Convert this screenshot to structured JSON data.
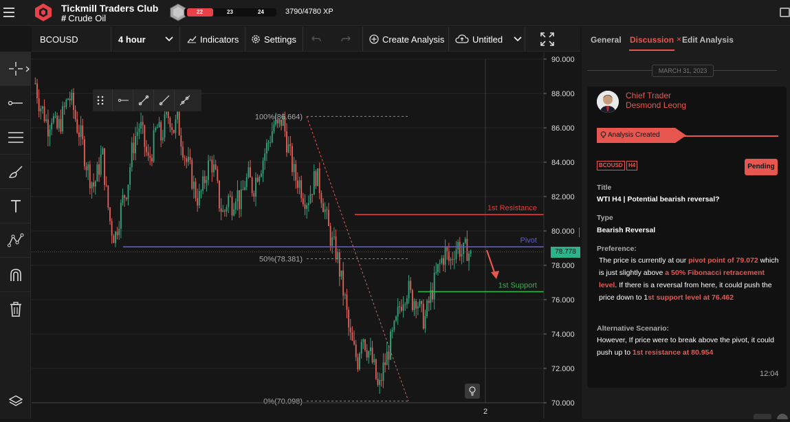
{
  "header": {
    "club_title": "Tickmill Traders Club",
    "club_sub": "Crude Oil",
    "level_current": "22",
    "level_mid": "23",
    "level_next": "24",
    "xp_text": "3790/4780 XP",
    "accent": "#e8414a"
  },
  "toolbar": {
    "symbol": "BCOUSD",
    "interval": "4 hour",
    "indicators": "Indicators",
    "settings": "Settings",
    "create_analysis": "Create Analysis",
    "untitled": "Untitled"
  },
  "left_tools": [
    {
      "icon": "crosshair-icon"
    },
    {
      "icon": "line-tool-icon"
    },
    {
      "icon": "fib-lines-icon"
    },
    {
      "icon": "brush-icon"
    },
    {
      "icon": "text-icon"
    },
    {
      "icon": "pattern-icon"
    },
    {
      "icon": "magnet-icon"
    },
    {
      "icon": "trash-icon"
    },
    {
      "icon": "layers-icon"
    }
  ],
  "chart_data": {
    "type": "candlestick",
    "y_ticks": [
      "90.000",
      "88.000",
      "86.000",
      "84.000",
      "82.000",
      "80.000",
      "78.000",
      "76.000",
      "74.000",
      "72.000",
      "70.000"
    ],
    "ylim": [
      70,
      90
    ],
    "x_tick": "2",
    "current_price": "78.778",
    "fib_levels": [
      {
        "label": "100%(86.664)",
        "value": 86.664
      },
      {
        "label": "50%(78.381)",
        "value": 78.381
      },
      {
        "label": "0%(70.098)",
        "value": 70.098
      }
    ],
    "lines": [
      {
        "label": "1st Resistance",
        "value": 80.954,
        "color": "#e23b3b"
      },
      {
        "label": "Pivot",
        "value": 79.072,
        "color": "#5b5bd6"
      },
      {
        "label": "1st Support",
        "value": 76.462,
        "color": "#2fb84a"
      }
    ],
    "close_path": [
      88.6,
      87.4,
      86.9,
      86.1,
      86.8,
      85.8,
      86.3,
      87.1,
      87.9,
      87.2,
      86.1,
      85.4,
      84.1,
      83.2,
      82.6,
      83.5,
      84.6,
      82.1,
      80.3,
      79.6,
      80.8,
      81.9,
      82.6,
      84.5,
      85.6,
      86.2,
      85.1,
      84.0,
      84.8,
      86.1,
      85.4,
      86.3,
      86.8,
      85.9,
      86.4,
      85.2,
      84.1,
      83.5,
      82.4,
      81.8,
      82.5,
      83.6,
      84.1,
      83.2,
      81.6,
      80.9,
      82.0,
      81.6,
      82.4,
      81.5,
      82.8,
      83.1,
      82.4,
      83.4,
      83.9,
      84.7,
      85.4,
      86.2,
      85.9,
      86.6,
      85.3,
      84.2,
      83.1,
      82.9,
      82.1,
      81.8,
      82.5,
      83.3,
      82.5,
      81.4,
      80.1,
      79.2,
      78.7,
      77.2,
      75.9,
      74.0,
      73.1,
      72.4,
      74.2,
      73.3,
      72.8,
      71.9,
      70.6,
      71.9,
      72.7,
      73.6,
      74.4,
      75.6,
      76.3,
      76.7,
      75.9,
      76.2,
      75.2,
      74.8,
      75.8,
      76.7,
      77.6,
      78.3,
      78.8,
      78.1,
      78.9,
      79.2,
      78.6,
      79.0,
      78.5
    ]
  },
  "panel": {
    "tab_general": "General",
    "tab_discussion": "Discussion",
    "tab_edit": "Edit Analysis",
    "date": "MARCH 31, 2023",
    "role": "Chief Trader",
    "name": "Desmond Leong",
    "status": "Analysis Created",
    "tag1": "BCOUSD",
    "tag2": "H4",
    "pending": "Pending",
    "title_label": "Title",
    "title_value": "WTI H4 | Potential bearish reversal?",
    "type_label": "Type",
    "type_value": "Bearish Reversal",
    "pref_label": "Preference:",
    "pref_1": "The price is currently at our ",
    "pref_hl1": "pivot point of 79.072",
    "pref_2": " which is just slightly above ",
    "pref_hl2": "a 50% Fibonacci retracement level",
    "pref_3": ". If there is a reversal from here, it could push the price down to 1",
    "pref_hl3": "st support level at 76.462",
    "alt_label": "Alternative Scenario:",
    "alt_1": "However, If price were to break above the pivot, it could push up to ",
    "alt_hl": "1st resistance at 80.954",
    "time": "12:04"
  }
}
